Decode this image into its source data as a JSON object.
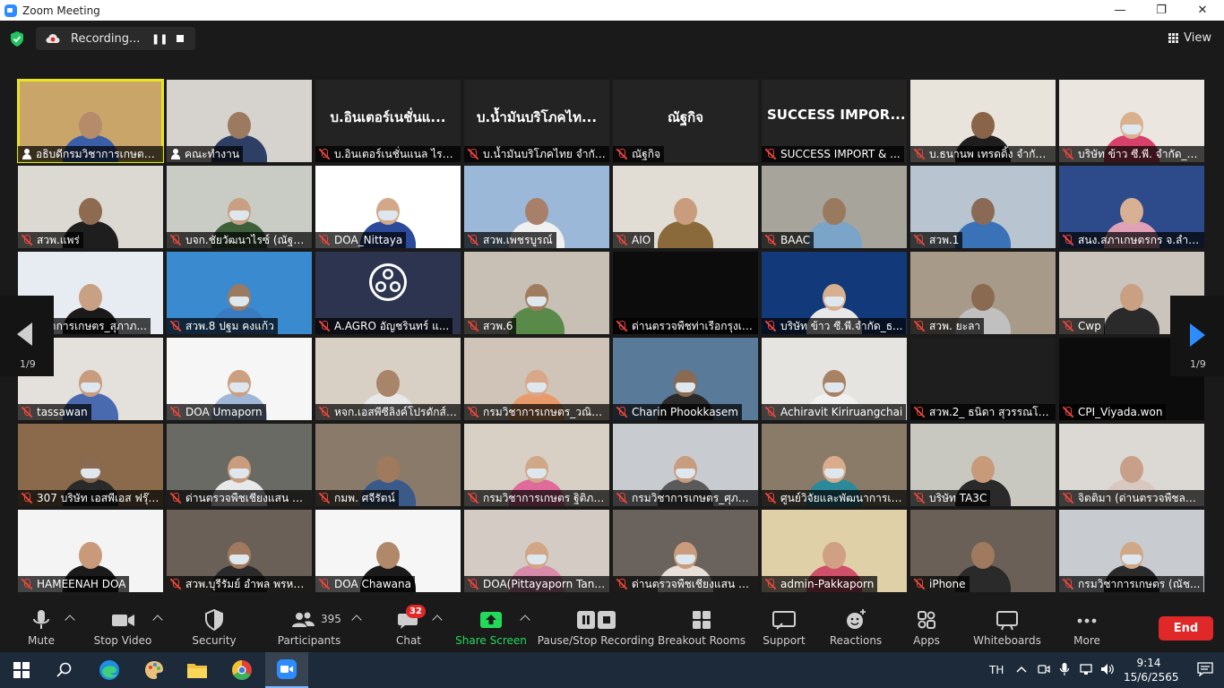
{
  "window": {
    "title": "Zoom Meeting",
    "minimize": "—",
    "maximize": "❐",
    "close": "✕"
  },
  "topbar": {
    "recording_label": "Recording...",
    "pause_glyph": "❚❚",
    "view_label": "View"
  },
  "pagination": {
    "left_page": "1/9",
    "right_page": "1/9"
  },
  "tiles": [
    {
      "name": "อธิบดีกรมวิชาการเกษตร (...",
      "icon": "host-icon",
      "active": true,
      "bg": "#c9a56a",
      "skin": "#b58b6a",
      "shirt": "#3a5fa8",
      "mask": false
    },
    {
      "name": "คณะทำงาน",
      "icon": "host-icon",
      "bg": "#d6d3ce",
      "skin": "#9c7a60",
      "shirt": "#2e3f66",
      "mask": false
    },
    {
      "name": "บ.อินเตอร์เนชั่นแนล ไรซ์ ...",
      "icon": "mute-icon",
      "bigname": "บ.อินเตอร์เนชั่นแ...",
      "bg": "#232323"
    },
    {
      "name": "บ.น้ำมันบริโภคไทย จำกัด_...",
      "icon": "mute-icon",
      "bigname": "บ.น้ำมันบริโภคไท...",
      "bg": "#232323"
    },
    {
      "name": "ณัฐกิจ",
      "icon": "mute-icon",
      "bigname": "ณัฐกิจ",
      "bg": "#232323"
    },
    {
      "name": "SUCCESS IMPORT & ...",
      "icon": "mute-icon",
      "bigname": "SUCCESS  IMPOR...",
      "bg": "#232323"
    },
    {
      "name": "บ.ธนานพ เทรดดิ้ง จำกัด_...",
      "icon": "mute-icon",
      "bg": "#e8e4dc",
      "skin": "#8a6448",
      "shirt": "#1e1e1e",
      "mask": false
    },
    {
      "name": "บริษัท ข้าว ซี.พี. จำกัด_ยู...",
      "icon": "mute-icon",
      "bg": "#ece6e0",
      "skin": "#d8b08e",
      "shirt": "#d7406a",
      "mask": true
    },
    {
      "name": "สวพ.แพร่",
      "icon": "mute-icon",
      "bg": "#dcd8d2",
      "skin": "#8e6a50",
      "shirt": "#1e1e1e",
      "mask": false
    },
    {
      "name": "บจก.ชัยวัฒนาไรซ์ (ณัฐม...",
      "icon": "mute-icon",
      "bg": "#c8ccc4",
      "skin": "#caa084",
      "shirt": "#3d5f3a",
      "mask": true
    },
    {
      "name": "DOA_Nittaya",
      "icon": "mute-icon",
      "bg": "#ffffff",
      "skin": "#d2a888",
      "shirt": "#2b4a9a",
      "mask": true
    },
    {
      "name": "สวพ.เพชรบูรณ์",
      "icon": "mute-icon",
      "bg": "#9cb8d8",
      "skin": "#a8806a",
      "shirt": "#f0f0f0",
      "mask": false
    },
    {
      "name": "AIO",
      "icon": "mute-icon",
      "bg": "#e2ddd4",
      "skin": "#c89c7c",
      "shirt": "#8a6a3a",
      "mask": false
    },
    {
      "name": "BAAC",
      "icon": "mute-icon",
      "bg": "#a7a49c",
      "skin": "#9a7a5e",
      "shirt": "#7aa4c8",
      "mask": false
    },
    {
      "name": "สวพ.1",
      "icon": "mute-icon",
      "bg": "#b8c4d0",
      "skin": "#8a6a54",
      "shirt": "#3a72b8",
      "mask": false
    },
    {
      "name": "สนง.สภาเกษตรกร จ.ลำพู...",
      "icon": "mute-icon",
      "bg": "#2d4b8a",
      "skin": "#d8b094",
      "shirt": "#e0a0b8",
      "mask": false
    },
    {
      "name": "วิชาการเกษตร_สุภาภ...",
      "icon": "mute-icon",
      "bg": "#e6ecf2",
      "skin": "#c8a084",
      "shirt": "#1a1a1a",
      "mask": false
    },
    {
      "name": "สวพ.8 ปฐม คงแก้ว",
      "icon": "mute-icon",
      "bg": "#3a8ad0",
      "skin": "#9a7a60",
      "shirt": "#3a7ac0",
      "mask": true
    },
    {
      "name": "A.AGRO อัญชรินทร์  แ...",
      "icon": "mute-icon",
      "obs": true,
      "bg": "#2c3450"
    },
    {
      "name": "สวพ.6",
      "icon": "mute-icon",
      "bg": "#c8c0b4",
      "skin": "#a07c5e",
      "shirt": "#5a8a4a",
      "mask": true
    },
    {
      "name": "ด่านตรวจพืชท่าเรือกรุงเท...",
      "icon": "mute-icon",
      "bg": "#0c0c0c",
      "hidden": true
    },
    {
      "name": "บริษัท ข้าว ซี.พี.จำกัด_ธ...",
      "icon": "mute-icon",
      "bg": "#123a7a",
      "skin": "#d8b090",
      "shirt": "#e8e8e8",
      "mask": true
    },
    {
      "name": "สวพ. ยะลา",
      "icon": "mute-icon",
      "bg": "#a89a88",
      "skin": "#8a6a50",
      "shirt": "#c0c0c0",
      "mask": false
    },
    {
      "name": "Cwp",
      "icon": "mute-icon",
      "bg": "#cac4bc",
      "skin": "#caa082",
      "shirt": "#2a2a2a",
      "mask": false
    },
    {
      "name": "tassawan",
      "icon": "mute-icon",
      "bg": "#e4e0dc",
      "skin": "#c89c7e",
      "shirt": "#4a6ab0",
      "mask": true
    },
    {
      "name": "DOA Umaporn",
      "icon": "mute-icon",
      "bg": "#f6f6f6",
      "skin": "#caa080",
      "shirt": "#a0b8d8",
      "mask": true
    },
    {
      "name": "หจก.เอสพีซีลิงค์โปรดักส์ จิ...",
      "icon": "mute-icon",
      "bg": "#d8d0c4",
      "skin": "#a88468",
      "shirt": "#e8e8e8",
      "mask": false
    },
    {
      "name": "กรมวิชาการเกษตร_วณิช...",
      "icon": "mute-icon",
      "bg": "#d0c4b8",
      "skin": "#d8a888",
      "shirt": "#e89a6a",
      "mask": true
    },
    {
      "name": "Charin Phookkasem",
      "icon": "mute-icon",
      "bg": "#5a7a9a",
      "skin": "#8a6a50",
      "shirt": "#2a2a2a",
      "mask": true
    },
    {
      "name": "Achiravit Kiriruangchai",
      "icon": "mute-icon",
      "bg": "#e6e4e0",
      "skin": "#a88264",
      "shirt": "#f0f0f0",
      "mask": true
    },
    {
      "name": "สวพ.2_ ธนิดา สุวรรณโบสถ",
      "icon": "mute-icon",
      "bg": "#1e1e1e",
      "hidden": true
    },
    {
      "name": "CPI_Viyada.won",
      "icon": "mute-icon",
      "bg": "#0c0c0c",
      "hidden": true
    },
    {
      "name": "307 บริษัท เอสพีเอส ฟรุ๊ต...",
      "icon": "mute-icon",
      "bg": "#8a6a4a",
      "skin": "#8a6a50",
      "shirt": "#2a2a2a",
      "mask": true
    },
    {
      "name": "ด่านตรวจพืชเชียงแสน ภา...",
      "icon": "mute-icon",
      "bg": "#6a6a64",
      "skin": "#c89c7c",
      "shirt": "#e8e8e8",
      "mask": true
    },
    {
      "name": "กมพ. ศจีรัตน์",
      "icon": "mute-icon",
      "bg": "#8a7a6a",
      "skin": "#a07a5c",
      "shirt": "#3a5a8a",
      "mask": false
    },
    {
      "name": "กรมวิชาการเกษตร ฐิติภา ...",
      "icon": "mute-icon",
      "bg": "#d8d0c4",
      "skin": "#d0a888",
      "shirt": "#e06a9a",
      "mask": true
    },
    {
      "name": "กรมวิชาการเกษตร_ศุภรร์...",
      "icon": "mute-icon",
      "bg": "#c8ccd0",
      "skin": "#c89c7e",
      "shirt": "#5a5a5a",
      "mask": true
    },
    {
      "name": "ศูนย์วิจัยและพัฒนาการเก...",
      "icon": "mute-icon",
      "bg": "#8a7a68",
      "skin": "#d8ac8c",
      "shirt": "#2a8a9a",
      "mask": true
    },
    {
      "name": "บริษัท TA3C",
      "icon": "mute-icon",
      "bg": "#c8c8c0",
      "skin": "#c89a7a",
      "shirt": "#2a2a2a",
      "mask": false
    },
    {
      "name": "จิตติมา (ด่านตรวจพืชลาด...",
      "icon": "mute-icon",
      "bg": "#dcd8d4",
      "skin": "#c8a08a",
      "shirt": "#d8c8c0",
      "mask": false
    },
    {
      "name": "HAMEENAH DOA",
      "icon": "mute-icon",
      "bg": "#f4f4f4",
      "skin": "#c89a7a",
      "shirt": "#1a1a1a",
      "mask": false
    },
    {
      "name": "สวพ.บุรีรัมย์ อำพล พรหม...",
      "icon": "mute-icon",
      "bg": "#6a6058",
      "skin": "#a07a5e",
      "shirt": "#2a2a2a",
      "mask": true
    },
    {
      "name": "DOA Chawana",
      "icon": "mute-icon",
      "bg": "#f6f6f6",
      "skin": "#b0886a",
      "shirt": "#1a1a1a",
      "mask": false
    },
    {
      "name": "DOA(Pittayaporn Tant...",
      "icon": "mute-icon",
      "bg": "#d4ccc4",
      "skin": "#d0a686",
      "shirt": "#d88aa8",
      "mask": true
    },
    {
      "name": "ด่านตรวจพืชเชียงแสน กฤ...",
      "icon": "mute-icon",
      "bg": "#6a625c",
      "skin": "#c89c7c",
      "shirt": "#e8e0d8",
      "mask": true
    },
    {
      "name": "admin-Pakkaporn",
      "icon": "mute-icon",
      "bg": "#e0d0a8",
      "skin": "#d0a084",
      "shirt": "#d0506a",
      "mask": false
    },
    {
      "name": "iPhone",
      "icon": "mute-icon",
      "bg": "#6a6058",
      "skin": "#a07a5e",
      "shirt": "#2a2a2a",
      "mask": false
    },
    {
      "name": "กรมวิชาการเกษตร (ณัช...",
      "icon": "mute-icon",
      "bg": "#c8ccd0",
      "skin": "#d0a888",
      "shirt": "#2a2a2a",
      "mask": true
    }
  ],
  "toolbar": {
    "mute": "Mute",
    "stop_video": "Stop Video",
    "security": "Security",
    "participants": "Participants",
    "participants_count": "395",
    "chat": "Chat",
    "chat_badge": "32",
    "share_screen": "Share Screen",
    "pause_stop_recording": "Pause/Stop Recording",
    "breakout_rooms": "Breakout Rooms",
    "support": "Support",
    "reactions": "Reactions",
    "apps": "Apps",
    "whiteboards": "Whiteboards",
    "more": "More",
    "end": "End"
  },
  "taskbar": {
    "language": "TH",
    "time": "9:14",
    "date": "15/6/2565"
  },
  "colors": {
    "accent": "#2d8cff",
    "end_red": "#e02828",
    "share_green": "#23d959",
    "active_speaker": "#e6e61a",
    "mute_red": "#e8453c"
  }
}
